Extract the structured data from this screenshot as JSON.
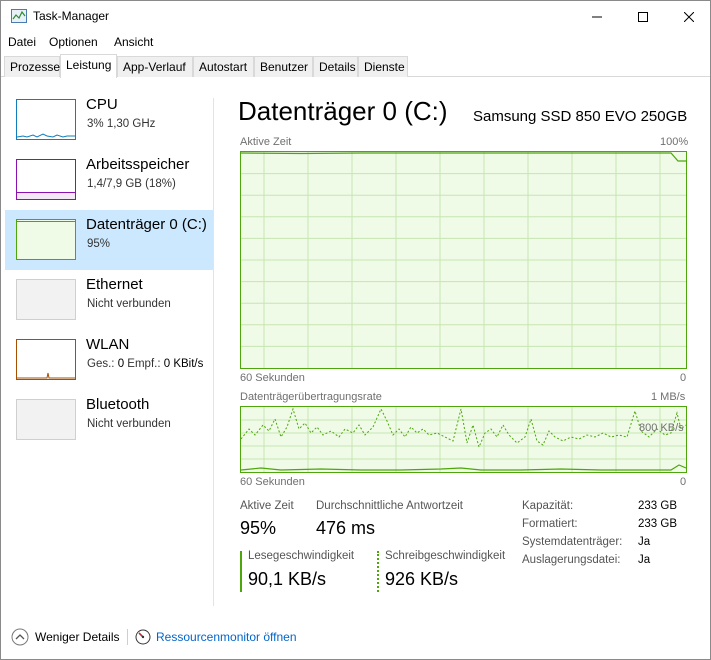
{
  "window": {
    "title": "Task-Manager"
  },
  "menu": [
    "Datei",
    "Optionen",
    "Ansicht"
  ],
  "tabs": [
    {
      "label": "Prozesse",
      "active": false
    },
    {
      "label": "Leistung",
      "active": true
    },
    {
      "label": "App-Verlauf",
      "active": false
    },
    {
      "label": "Autostart",
      "active": false
    },
    {
      "label": "Benutzer",
      "active": false
    },
    {
      "label": "Details",
      "active": false
    },
    {
      "label": "Dienste",
      "active": false
    }
  ],
  "sidebar": {
    "items": [
      {
        "title": "CPU",
        "sub": "3%  1,30 GHz",
        "color": "#117dbb",
        "selected": false
      },
      {
        "title": "Arbeitsspeicher",
        "sub": "1,4/7,9 GB (18%)",
        "color": "#8b12ae",
        "selected": false
      },
      {
        "title": "Datenträger 0 (C:)",
        "sub": "95%",
        "color": "#4da60c",
        "selected": true
      },
      {
        "title": "Ethernet",
        "sub": "Nicht verbunden",
        "color": "#a7a7a7",
        "selected": false
      },
      {
        "title": "WLAN",
        "sub_parts": [
          "Ges.:",
          "0",
          "Empf.:",
          "0 KBit/s"
        ],
        "color": "#a74f01",
        "selected": false
      },
      {
        "title": "Bluetooth",
        "sub": "Nicht verbunden",
        "color": "#a7a7a7",
        "selected": false
      }
    ]
  },
  "detail": {
    "title": "Datenträger 0 (C:)",
    "device": "Samsung SSD 850 EVO 250GB",
    "graph1": {
      "label": "Aktive Zeit",
      "max": "100%",
      "xlabel": "60 Sekunden",
      "min": "0"
    },
    "graph2": {
      "label": "Datenträgerübertragungsrate",
      "max": "1 MB/s",
      "mid": "800 KB/s",
      "xlabel": "60 Sekunden",
      "min": "0"
    },
    "stats": {
      "active_time_label": "Aktive Zeit",
      "active_time_value": "95%",
      "response_label": "Durchschnittliche Antwortzeit",
      "response_value": "476 ms",
      "read_label": "Lesegeschwindigkeit",
      "read_value": "90,1 KB/s",
      "write_label": "Schreibgeschwindigkeit",
      "write_value": "926 KB/s"
    },
    "properties": [
      {
        "key": "Kapazität:",
        "value": "233 GB"
      },
      {
        "key": "Formatiert:",
        "value": "233 GB"
      },
      {
        "key": "Systemdatenträger:",
        "value": "Ja"
      },
      {
        "key": "Auslagerungsdatei:",
        "value": "Ja"
      }
    ]
  },
  "footer": {
    "less_details": "Weniger Details",
    "resource_monitor": "Ressourcenmonitor öffnen"
  },
  "colors": {
    "disk": "#4da60c",
    "disk_fill": "#effae7",
    "selected_bg": "#cce8ff",
    "link": "#0066cc"
  }
}
